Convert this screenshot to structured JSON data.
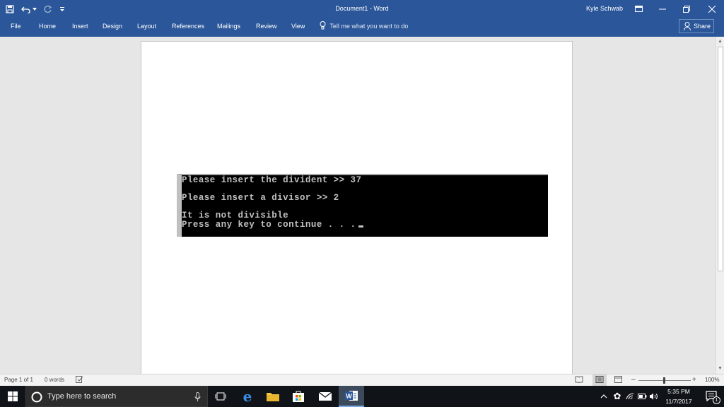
{
  "window": {
    "title": "Document1 - Word",
    "user": "Kyle Schwab"
  },
  "ribbon": {
    "tabs": [
      "File",
      "Home",
      "Insert",
      "Design",
      "Layout",
      "References",
      "Mailings",
      "Review",
      "View"
    ],
    "tell_me": "Tell me what you want to do",
    "share": "Share"
  },
  "document": {
    "console_lines": [
      "Please insert the divident >> 37",
      "Please insert a divisor >> 2",
      "It is not divisible",
      "Press any key to continue . . ."
    ]
  },
  "statusbar": {
    "page": "Page 1 of 1",
    "words": "0 words",
    "zoom": "100%"
  },
  "taskbar": {
    "search_placeholder": "Type here to search",
    "time": "5:35 PM",
    "date": "11/7/2017",
    "notification_count": "1"
  },
  "colors": {
    "ribbon": "#2b579a",
    "taskbar": "#101418",
    "console_bg": "#000000",
    "console_text": "#c0c0c0"
  }
}
